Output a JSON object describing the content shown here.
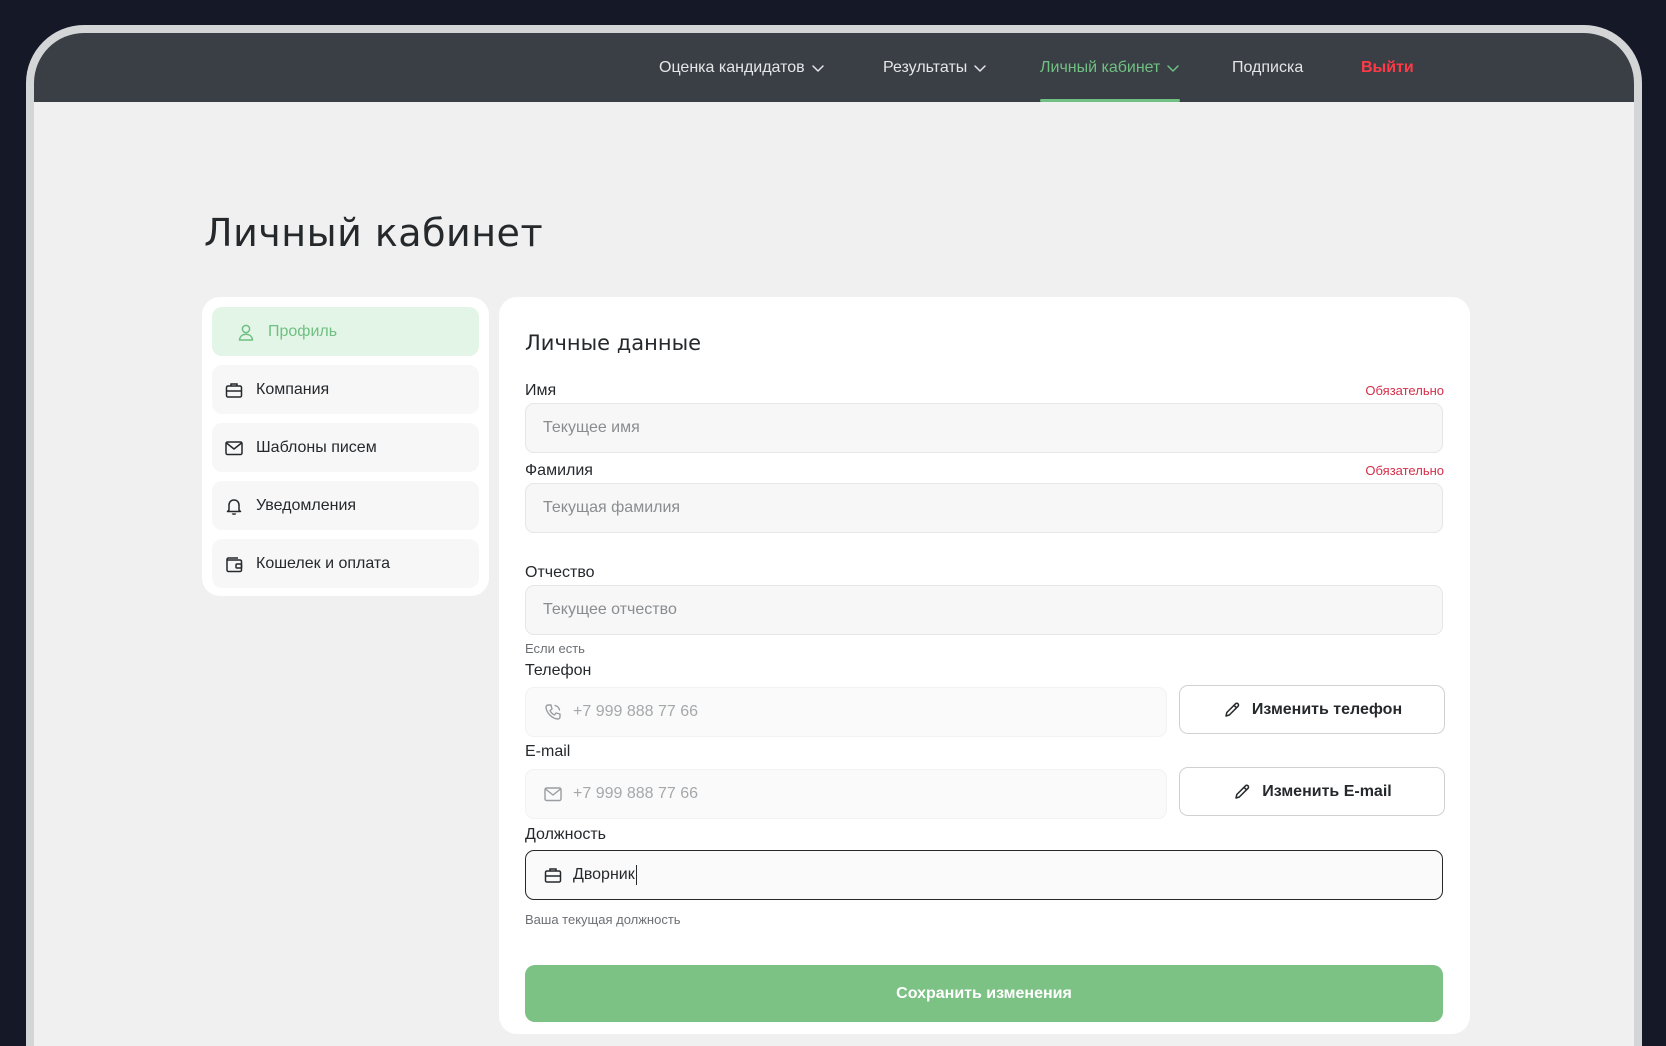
{
  "nav": {
    "items": [
      {
        "label": "Оценка кандидатов",
        "has_dropdown": true
      },
      {
        "label": "Результаты",
        "has_dropdown": true
      },
      {
        "label": "Личный кабинет",
        "has_dropdown": true,
        "active": true
      },
      {
        "label": "Подписка",
        "has_dropdown": false
      }
    ],
    "logout_label": "Выйти"
  },
  "page": {
    "title": "Личный кабинет"
  },
  "sidebar": {
    "items": [
      {
        "label": "Профиль",
        "icon": "user-icon",
        "active": true
      },
      {
        "label": "Компания",
        "icon": "briefcase-icon"
      },
      {
        "label": "Шаблоны писем",
        "icon": "mail-icon"
      },
      {
        "label": "Уведомления",
        "icon": "bell-icon"
      },
      {
        "label": "Кошелек и оплата",
        "icon": "wallet-icon"
      }
    ]
  },
  "form": {
    "title": "Личные данные",
    "first_name": {
      "label": "Имя",
      "required": "Обязательно",
      "placeholder": "Текущее имя"
    },
    "last_name": {
      "label": "Фамилия",
      "required": "Обязательно",
      "placeholder": "Текущая фамилия"
    },
    "middle_name": {
      "label": "Отчество",
      "placeholder": "Текущее отчество",
      "hint": "Если есть"
    },
    "phone": {
      "label": "Телефон",
      "placeholder": "+7 999 888 77 66",
      "button": "Изменить телефон"
    },
    "email": {
      "label": "E-mail",
      "placeholder": "+7 999 888 77 66",
      "button": "Изменить E-mail"
    },
    "position": {
      "label": "Должность",
      "value": "Дворник",
      "hint": "Ваша текущая должность"
    },
    "save_label": "Сохранить изменения"
  },
  "colors": {
    "accent": "#6fc082",
    "save_button": "#7cc285",
    "danger": "#ff3946",
    "topbar": "#3a3f45"
  }
}
